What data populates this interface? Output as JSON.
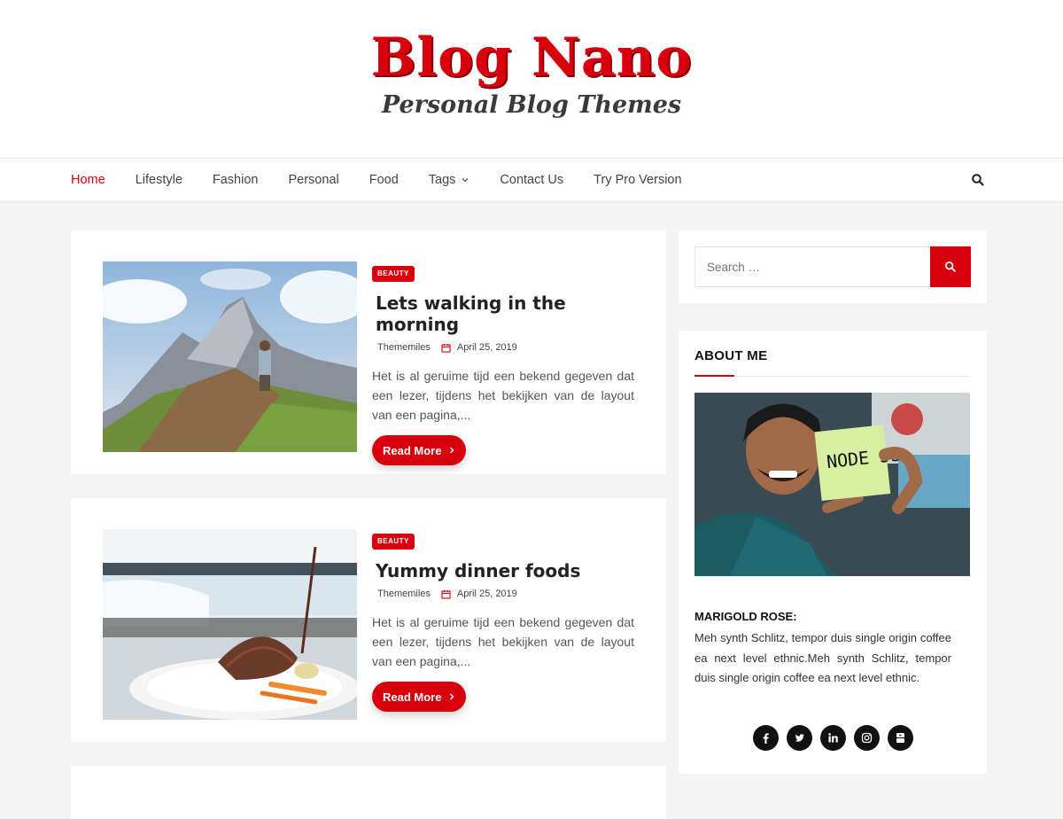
{
  "header": {
    "title": "Blog Nano",
    "tagline": "Personal Blog Themes"
  },
  "nav": {
    "items": [
      {
        "label": "Home",
        "active": true
      },
      {
        "label": "Lifestyle"
      },
      {
        "label": "Fashion"
      },
      {
        "label": "Personal"
      },
      {
        "label": "Food"
      },
      {
        "label": "Tags",
        "dropdown": true
      },
      {
        "label": "Contact Us"
      },
      {
        "label": "Try Pro Version"
      }
    ],
    "search_icon": "search-icon"
  },
  "posts": [
    {
      "category": "BEAUTY",
      "title": "Lets walking in the morning",
      "author": "Thememiles",
      "date": "April 25, 2019",
      "excerpt": "Het is al geruime tijd een bekend gegeven dat een lezer, tijdens het bekijken van de layout van een pagina,...",
      "read_more": "Read More",
      "image": "mountain-hiker-photo"
    },
    {
      "category": "BEAUTY",
      "title": "Yummy dinner foods",
      "author": "Thememiles",
      "date": "April 25, 2019",
      "excerpt": "Het is al geruime tijd een bekend gegeven dat een lezer, tijdens het bekijken van de layout van een pagina,...",
      "read_more": "Read More",
      "image": "steak-waterfall-photo"
    }
  ],
  "sidebar": {
    "search": {
      "placeholder": "Search …"
    },
    "about": {
      "title": "ABOUT ME",
      "photo_note": "NODE JS",
      "name": "MARIGOLD  ROSE:",
      "text": "Meh synth Schlitz, tempor duis single origin coffee ea next level ethnic.Meh synth Schlitz, tempor duis single origin coffee ea next level ethnic.",
      "social": [
        "facebook-icon",
        "twitter-icon",
        "linkedin-icon",
        "instagram-icon",
        "youtube-icon"
      ]
    }
  },
  "colors": {
    "accent": "#d8000c",
    "background": "#f4f4f4"
  }
}
